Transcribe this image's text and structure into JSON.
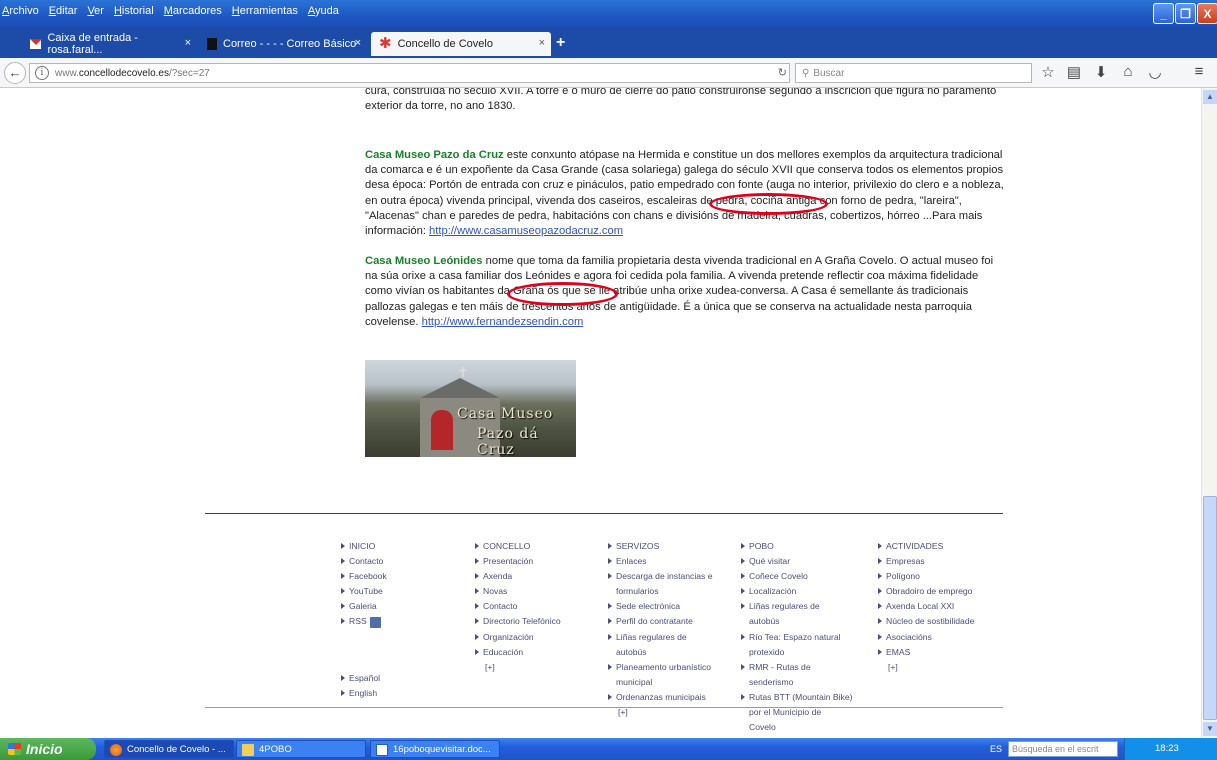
{
  "menu": [
    "Archivo",
    "Editar",
    "Ver",
    "Historial",
    "Marcadores",
    "Herramientas",
    "Ayuda"
  ],
  "tabs": [
    {
      "label": "Caixa de entrada - rosa.faral...",
      "close": "×",
      "icon": "gmail-icon"
    },
    {
      "label": "Correo - - - - Correo Básico",
      "close": "×",
      "icon": "correo-icon"
    },
    {
      "label": "Concello de Covelo",
      "close": "×",
      "icon": "covelo-icon",
      "active": true
    }
  ],
  "new_tab": "+",
  "url": {
    "prefix": "www.",
    "domain": "concellodecovelo.es",
    "path": "/?sec=27"
  },
  "search_placeholder": "Buscar",
  "window_buttons": {
    "min": "_",
    "max": "❐",
    "close": "X"
  },
  "content": {
    "p1_text": "cura, construída no século XVII. A torre e o muro de cierre do patio construironse segundo a inscrición que figura no paramento exterior da torre, no ano 1830.",
    "p2_title": "Casa Museo Pazo da Cruz",
    "p2_text": " este conxunto atópase na Hermida e constitue un dos mellores exemplos da arquitectura tradicional da comarca e é un expoñente da Casa Grande (casa solariega) galega do século XVII que conserva todos os elementos propios desa época: Portón de entrada con cruz e pináculos, patio empedrado con fonte (auga no interior, privilexio do clero e a nobleza, en outra época) vivenda principal, vivenda dos caseiros, escaleiras de pedra, cociña antiga con forno de pedra, \"lareira\", \"Alacenas\" chan e paredes de pedra, habitacións con chans e divisións de madeira, cuadras, cobertizos, hórreo ...Para mais información: ",
    "p2_link": "http://www.casamuseopazodacruz.com",
    "p3_title": "Casa Museo Leónides",
    "p3_text": " nome que toma da familia propietaria desta vivenda tradicional en  A Graña Covelo. O actual museo foi na súa orixe a casa familiar dos Leónides e agora foi cedida pola familia. A vivenda pretende reflectir coa máxima fidelidade como vivían os habitantes da Graña ós que se lle atribúe unha orixe xudea-conversa. A Casa é semellante ás tradicionais pallozas galegas e ten máis de trescentos anos de antigüidade. É a única que se conserva na actualidade nesta parroquia covelense. ",
    "p3_link": "http://www.fernandezsendin.com",
    "image_caption_1": "Casa Museo",
    "image_caption_2": "Pazo dá Cruz"
  },
  "footer": {
    "col1": [
      "INICIO",
      "Contacto",
      "Facebook",
      "YouTube",
      "Galeria",
      "RSS"
    ],
    "col2": [
      "CONCELLO",
      "Presentación",
      "Axenda",
      "Novas",
      "Contacto",
      "Directorio Telefónico",
      "Organización",
      "Educación"
    ],
    "col3": [
      "SERVIZOS",
      "Enlaces",
      "Descarga de instancias e",
      "formularios",
      "Sede electrónica",
      "Perfil do contratante",
      "Liñas regulares de",
      "autobús",
      "Planeamento urbanístico",
      "municipal",
      "Ordenanzas municipais"
    ],
    "col4": [
      "POBO",
      "Qué visitar",
      "Coñece Covelo",
      "Localización",
      "Liñas regulares de",
      "autobús",
      "Río Tea: Espazo natural",
      "protexido",
      "RMR - Rutas de",
      "senderismo",
      "Rutas BTT (Mountain Bike)",
      "por el Municipio de",
      "Covelo"
    ],
    "col5": [
      "ACTIVIDADES",
      "Empresas",
      "Polígono",
      "Obradoiro de emprego",
      "Axenda Local XXI",
      "Núcleo de sostibilidade",
      "Asociacións",
      "EMAS"
    ],
    "more": "[+]",
    "lang": [
      "Español",
      "English"
    ]
  },
  "taskbar": {
    "start": "Inicio",
    "tasks": [
      "Concello de Covelo - ...",
      "4POBO",
      "16poboquevisitar.doc..."
    ],
    "lang": "ES",
    "search_placeholder": "Búsqueda en el escrit",
    "clock": "18:23"
  }
}
